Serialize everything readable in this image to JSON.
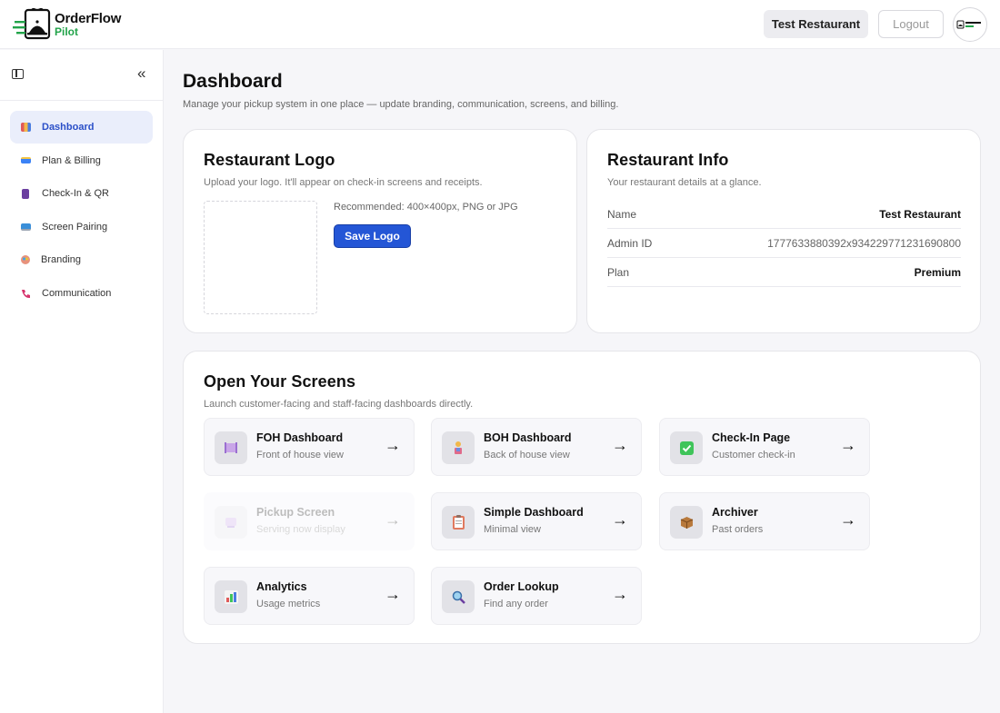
{
  "header": {
    "brand_name": "OrderFlow",
    "brand_sub": "Pilot",
    "restaurant": "Test Restaurant",
    "logout": "Logout",
    "avatar_text": "OrderFlow Pilot"
  },
  "sidebar": {
    "items": [
      {
        "label": "Dashboard",
        "icon": "chart-icon",
        "color": "#5b7be0"
      },
      {
        "label": "Plan & Billing",
        "icon": "credit-card-icon",
        "color": "#3b82f6"
      },
      {
        "label": "Check-In & QR",
        "icon": "phone-icon",
        "color": "#6b3fa0"
      },
      {
        "label": "Screen Pairing",
        "icon": "monitor-icon",
        "color": "#3a8fd9"
      },
      {
        "label": "Branding",
        "icon": "palette-icon",
        "color": "#e07a5f"
      },
      {
        "label": "Communication",
        "icon": "telephone-icon",
        "color": "#d6336c"
      }
    ]
  },
  "page": {
    "title": "Dashboard",
    "subtitle": "Manage your pickup system in one place — update branding, communication, screens, and billing."
  },
  "logo_card": {
    "title": "Restaurant Logo",
    "subtitle": "Upload your logo. It'll appear on check-in screens and receipts.",
    "hint": "Recommended: 400×400px, PNG or JPG",
    "save": "Save Logo"
  },
  "info_card": {
    "title": "Restaurant Info",
    "subtitle": "Your restaurant details at a glance.",
    "rows": [
      {
        "label": "Name",
        "value": "Test Restaurant"
      },
      {
        "label": "Admin ID",
        "value": "1777633880392x934229771231690800"
      },
      {
        "label": "Plan",
        "value": "Premium"
      }
    ]
  },
  "screens_card": {
    "title": "Open Your Screens",
    "subtitle": "Launch customer-facing and staff-facing dashboards directly.",
    "tiles": [
      {
        "title": "FOH Dashboard",
        "sub": "Front of house view",
        "icon": "plate-icon",
        "disabled": false
      },
      {
        "title": "BOH Dashboard",
        "sub": "Back of house view",
        "icon": "chef-icon",
        "disabled": false
      },
      {
        "title": "Check-In Page",
        "sub": "Customer check-in",
        "icon": "checkmark-icon",
        "disabled": false
      },
      {
        "title": "Pickup Screen",
        "sub": "Serving now display",
        "icon": "tray-icon",
        "disabled": true
      },
      {
        "title": "Simple Dashboard",
        "sub": "Minimal view",
        "icon": "clipboard-icon",
        "disabled": false
      },
      {
        "title": "Archiver",
        "sub": "Past orders",
        "icon": "box-icon",
        "disabled": false
      },
      {
        "title": "Analytics",
        "sub": "Usage metrics",
        "icon": "bar-chart-icon",
        "disabled": false
      },
      {
        "title": "Order Lookup",
        "sub": "Find any order",
        "icon": "magnifier-icon",
        "disabled": false
      }
    ]
  }
}
